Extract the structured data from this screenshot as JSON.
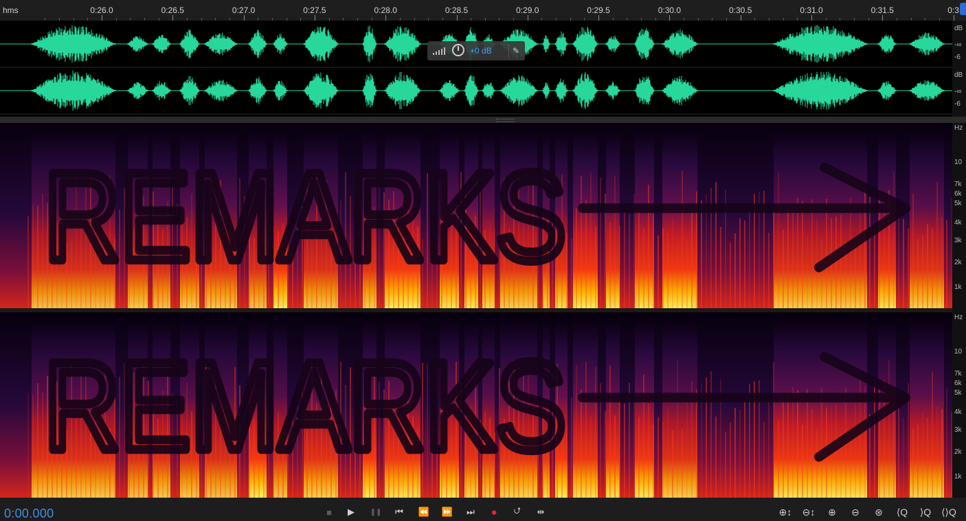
{
  "ruler": {
    "unit_label": "hms",
    "ticks": [
      "0:26.0",
      "0:26.5",
      "0:27.0",
      "0:27.5",
      "0:28.0",
      "0:28.5",
      "0:29.0",
      "0:29.5",
      "0:30.0",
      "0:30.5",
      "0:31.0",
      "0:31.5",
      "0:3"
    ]
  },
  "waveform": {
    "channel_scale": {
      "top": "dB",
      "mid": "-∞",
      "bottom": "-6"
    },
    "color": "#27d89a"
  },
  "hud": {
    "gain": "+0 dB"
  },
  "spectral": {
    "scale_labels": [
      "Hz",
      "10",
      "7k",
      "6k",
      "5k",
      "4k",
      "3k",
      "2k",
      "1k"
    ],
    "handwritten_overlay": "REMARKS"
  },
  "transport": {
    "time": "0:00.000",
    "buttons": {
      "stop": "■",
      "play": "▶",
      "pause": "❚❚",
      "go_start": "⏮",
      "rewind": "⏪",
      "forward": "⏩",
      "go_end": "⏭",
      "record": "●",
      "loop": "⮍",
      "skip": "⇹"
    },
    "zoom_buttons": [
      "⊕↕",
      "⊖↕",
      "⊕",
      "⊖",
      "⊛",
      "⟨Q",
      "⟩Q",
      "⟨⟩Q"
    ]
  }
}
